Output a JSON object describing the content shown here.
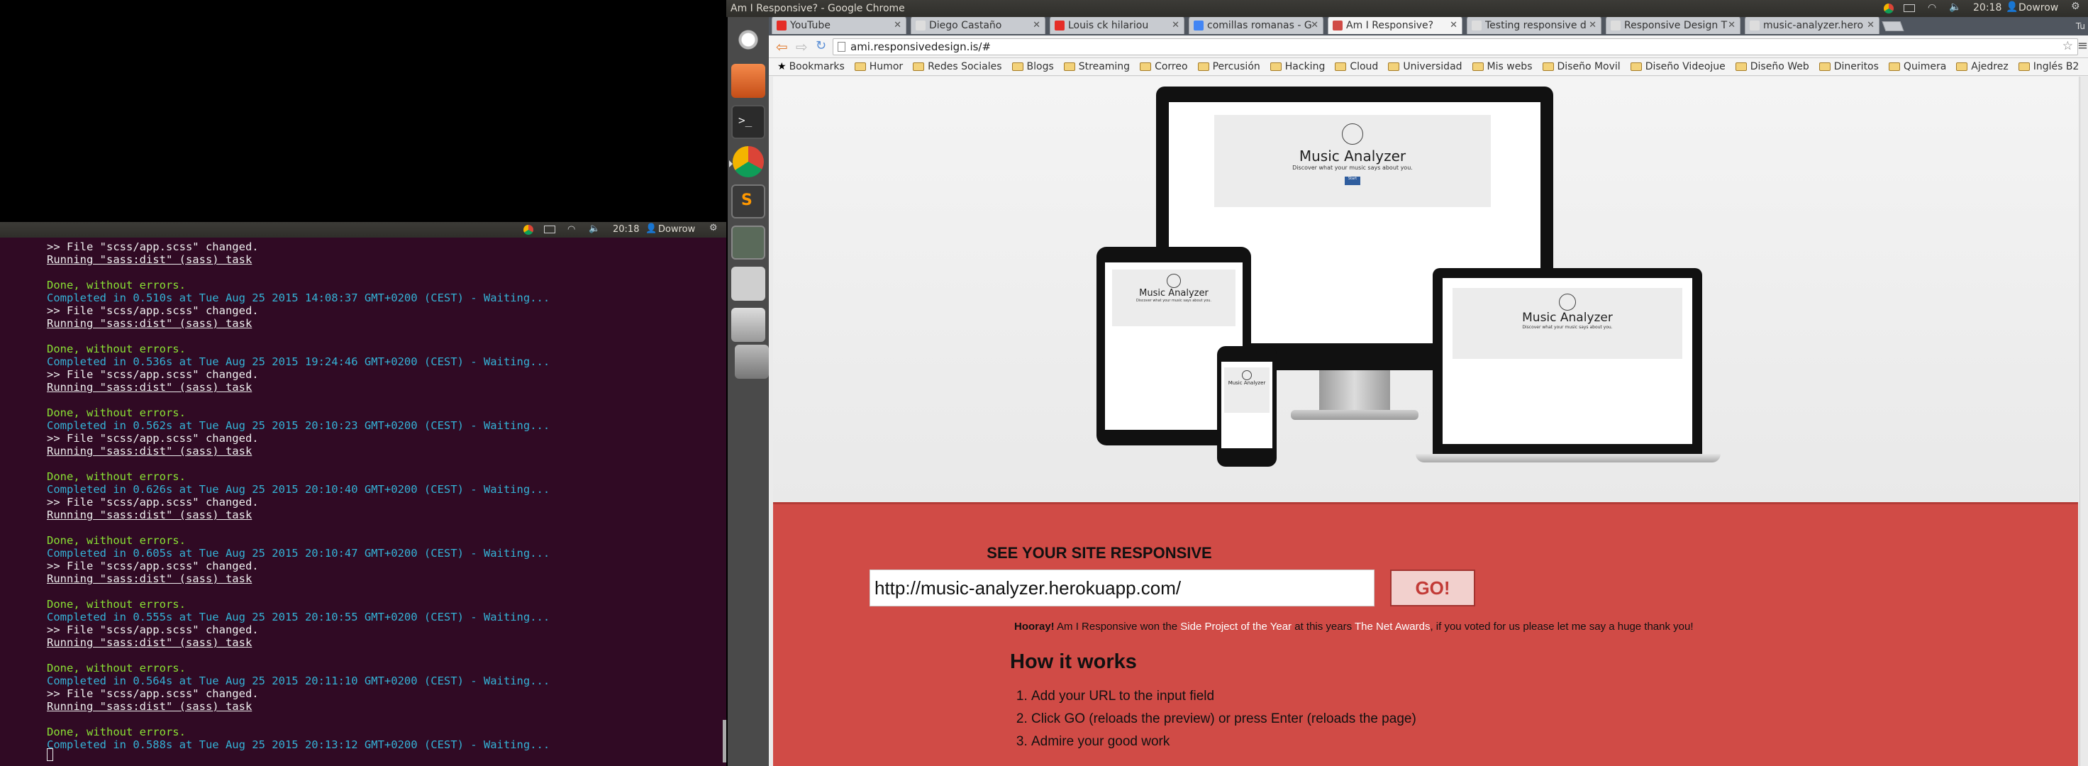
{
  "desktop": {
    "window_title": "Am I Responsive? - Google Chrome",
    "clock": "20:18",
    "user": "Dowrow"
  },
  "inner_panel": {
    "clock": "20:18",
    "user": "Dowrow"
  },
  "terminal": {
    "lines": [
      {
        "text": ">> File \"scss/app.scss\" changed.",
        "style": "white"
      },
      {
        "text": "Running \"sass:dist\" (sass) task",
        "style": "ul"
      },
      {
        "text": "",
        "style": "white"
      },
      {
        "text": "Done, without errors.",
        "style": "green"
      },
      {
        "text": "Completed in 0.510s at Tue Aug 25 2015 14:08:37 GMT+0200 (CEST) - Waiting...",
        "style": "cyan"
      },
      {
        "text": ">> File \"scss/app.scss\" changed.",
        "style": "white"
      },
      {
        "text": "Running \"sass:dist\" (sass) task",
        "style": "ul"
      },
      {
        "text": "",
        "style": "white"
      },
      {
        "text": "Done, without errors.",
        "style": "green"
      },
      {
        "text": "Completed in 0.536s at Tue Aug 25 2015 19:24:46 GMT+0200 (CEST) - Waiting...",
        "style": "cyan"
      },
      {
        "text": ">> File \"scss/app.scss\" changed.",
        "style": "white"
      },
      {
        "text": "Running \"sass:dist\" (sass) task",
        "style": "ul"
      },
      {
        "text": "",
        "style": "white"
      },
      {
        "text": "Done, without errors.",
        "style": "green"
      },
      {
        "text": "Completed in 0.562s at Tue Aug 25 2015 20:10:23 GMT+0200 (CEST) - Waiting...",
        "style": "cyan"
      },
      {
        "text": ">> File \"scss/app.scss\" changed.",
        "style": "white"
      },
      {
        "text": "Running \"sass:dist\" (sass) task",
        "style": "ul"
      },
      {
        "text": "",
        "style": "white"
      },
      {
        "text": "Done, without errors.",
        "style": "green"
      },
      {
        "text": "Completed in 0.626s at Tue Aug 25 2015 20:10:40 GMT+0200 (CEST) - Waiting...",
        "style": "cyan"
      },
      {
        "text": ">> File \"scss/app.scss\" changed.",
        "style": "white"
      },
      {
        "text": "Running \"sass:dist\" (sass) task",
        "style": "ul"
      },
      {
        "text": "",
        "style": "white"
      },
      {
        "text": "Done, without errors.",
        "style": "green"
      },
      {
        "text": "Completed in 0.605s at Tue Aug 25 2015 20:10:47 GMT+0200 (CEST) - Waiting...",
        "style": "cyan"
      },
      {
        "text": ">> File \"scss/app.scss\" changed.",
        "style": "white"
      },
      {
        "text": "Running \"sass:dist\" (sass) task",
        "style": "ul"
      },
      {
        "text": "",
        "style": "white"
      },
      {
        "text": "Done, without errors.",
        "style": "green"
      },
      {
        "text": "Completed in 0.555s at Tue Aug 25 2015 20:10:55 GMT+0200 (CEST) - Waiting...",
        "style": "cyan"
      },
      {
        "text": ">> File \"scss/app.scss\" changed.",
        "style": "white"
      },
      {
        "text": "Running \"sass:dist\" (sass) task",
        "style": "ul"
      },
      {
        "text": "",
        "style": "white"
      },
      {
        "text": "Done, without errors.",
        "style": "green"
      },
      {
        "text": "Completed in 0.564s at Tue Aug 25 2015 20:11:10 GMT+0200 (CEST) - Waiting...",
        "style": "cyan"
      },
      {
        "text": ">> File \"scss/app.scss\" changed.",
        "style": "white"
      },
      {
        "text": "Running \"sass:dist\" (sass) task",
        "style": "ul"
      },
      {
        "text": "",
        "style": "white"
      },
      {
        "text": "Done, without errors.",
        "style": "green"
      },
      {
        "text": "Completed in 0.588s at Tue Aug 25 2015 20:13:12 GMT+0200 (CEST) - Waiting...",
        "style": "cyan"
      }
    ]
  },
  "browser": {
    "tabs": [
      {
        "label": "YouTube",
        "icon": "youtube-icon",
        "active": false
      },
      {
        "label": "Diego Castaño",
        "icon": "page-icon",
        "active": false
      },
      {
        "label": "Louis ck hilariou",
        "icon": "youtube-icon",
        "active": false
      },
      {
        "label": "comillas romanas - G",
        "icon": "google-icon",
        "active": false
      },
      {
        "label": "Am I Responsive?",
        "icon": "amiresponsive-icon",
        "active": true
      },
      {
        "label": "Testing responsive d",
        "icon": "page-icon",
        "active": false
      },
      {
        "label": "Responsive Design T",
        "icon": "page-icon",
        "active": false
      },
      {
        "label": "music-analyzer.hero",
        "icon": "page-icon",
        "active": false
      }
    ],
    "address": "ami.responsivedesign.is/#",
    "bookmarks_label": "Bookmarks",
    "bookmarks": [
      "Humor",
      "Redes Sociales",
      "Blogs",
      "Streaming",
      "Correo",
      "Percusión",
      "Hacking",
      "Cloud",
      "Universidad",
      "Mis webs",
      "Diseño Movil",
      "Diseño Videojue",
      "Diseño Web",
      "Dineritos",
      "Quimera",
      "Ajedrez",
      "Inglés B2"
    ],
    "lang_indicator": "Tu"
  },
  "page": {
    "mock_title": "Music Analyzer",
    "mock_subtitle": "Discover what your music says about you.",
    "mock_button": "Start",
    "heading": "SEE YOUR SITE RESPONSIVE",
    "url_value": "http://music-analyzer.herokuapp.com/",
    "go_label": "GO!",
    "notice_bold": "Hooray!",
    "notice_1": " Am I Responsive won the ",
    "notice_link1": "Side Project of the Year",
    "notice_2": " at this years ",
    "notice_link2": "The Net Awards",
    "notice_3": ", if you voted for us please let me say a huge thank you!",
    "how_title": "How it works",
    "steps": [
      "Add your URL to the input field",
      "Click GO (reloads the preview) or press Enter (reloads the page)",
      "Admire your good work"
    ]
  },
  "colors": {
    "page_red": "#d04b46",
    "terminal_bg": "#300a24"
  }
}
